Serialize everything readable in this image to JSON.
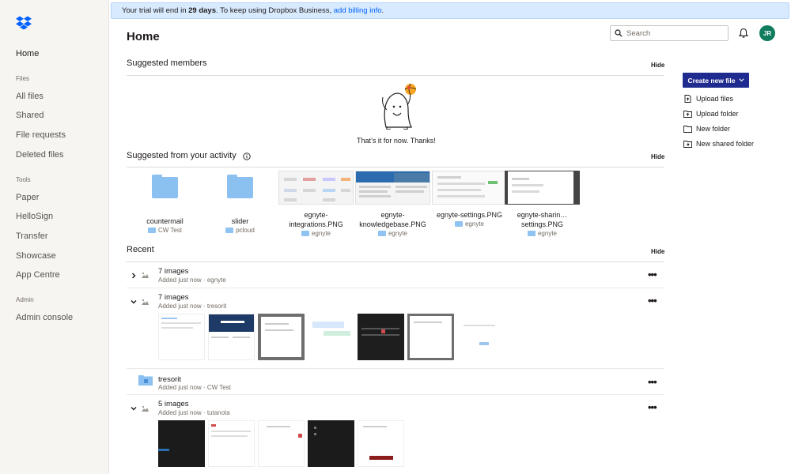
{
  "banner": {
    "prefix": "Your trial will end in",
    "days": "29 days",
    "middle": ". To keep using Dropbox Business,",
    "link": "add billing info",
    "suffix": "."
  },
  "sidebar": {
    "home": "Home",
    "files_section": "Files",
    "files": [
      "All files",
      "Shared",
      "File requests",
      "Deleted files"
    ],
    "tools_section": "Tools",
    "tools": [
      "Paper",
      "HelloSign",
      "Transfer",
      "Showcase",
      "App Centre"
    ],
    "admin_section": "Admin",
    "admin": [
      "Admin console"
    ]
  },
  "header": {
    "title": "Home",
    "search_placeholder": "Search",
    "avatar_initials": "JR"
  },
  "suggested_members": {
    "title": "Suggested members",
    "hide": "Hide",
    "empty_text": "That’s it for now. Thanks!"
  },
  "suggested_activity": {
    "title": "Suggested from your activity",
    "hide": "Hide",
    "items": [
      {
        "name": "countermail",
        "location": "CW Test",
        "kind": "folder"
      },
      {
        "name": "slider",
        "location": "pcloud",
        "kind": "folder"
      },
      {
        "name": "egnyte-integrations.PNG",
        "location": "egnyte",
        "kind": "image"
      },
      {
        "name": "egnyte-knowledgebase.PNG",
        "location": "egnyte",
        "kind": "image"
      },
      {
        "name": "egnyte-settings.PNG",
        "location": "egnyte",
        "kind": "image"
      },
      {
        "name": "egnyte-sharin… settings.PNG",
        "location": "egnyte",
        "kind": "image"
      }
    ]
  },
  "recent": {
    "title": "Recent",
    "hide": "Hide",
    "rows": [
      {
        "title": "7 images",
        "subtitle": "Added just now · egnyte",
        "expanded": false
      },
      {
        "title": "7 images",
        "subtitle": "Added just now · tresorit",
        "expanded": true
      },
      {
        "title": "tresorit",
        "subtitle": "Added just now · CW Test",
        "expanded": false
      },
      {
        "title": "5 images",
        "subtitle": "Added just now · tutanota",
        "expanded": true
      }
    ],
    "more": "•••"
  },
  "actions": {
    "create": "Create new file",
    "items": [
      "Upload files",
      "Upload folder",
      "New folder",
      "New shared folder"
    ]
  },
  "colors": {
    "accent": "#1f2b8f",
    "link": "#0061fe",
    "avatar": "#0f7c5e",
    "folder": "#8ac1f0"
  }
}
